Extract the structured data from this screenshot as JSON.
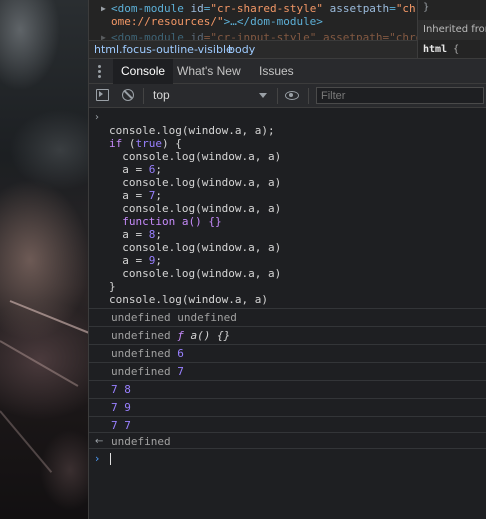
{
  "elements": {
    "line1": {
      "tag_open": "<dom-module ",
      "attr_name": "id",
      "attr_eq": "=",
      "attr_value": "\"cr-shared-style\"",
      "attr2_name": " assetpath",
      "attr2_eq": "=",
      "attr2_value": "\"chr"
    },
    "line2": {
      "value_cont": "ome://resources/\"",
      "tag_rest": ">…</dom-module>"
    },
    "line3": {
      "tag_open": "<dom-module ",
      "attr_name": "id",
      "attr_value": "=\"cr-input-style\" assetpath=\"chro"
    },
    "breadcrumbs": [
      "html.focus-outline-visible",
      "body"
    ]
  },
  "styles": {
    "brace": "}",
    "inherited_label": "Inherited from",
    "selector": "html",
    "selector_brace": "{"
  },
  "tabs": [
    {
      "label": "Console",
      "active": true
    },
    {
      "label": "What's New",
      "active": false
    },
    {
      "label": "Issues",
      "active": false
    }
  ],
  "toolbar": {
    "context": "top",
    "filter_placeholder": "Filter",
    "filter_value": ""
  },
  "console": {
    "input_lines": [
      "console.log(window.a, a);",
      "if (true) {",
      "  console.log(window.a, a)",
      "  a = 6;",
      "  console.log(window.a, a)",
      "  a = 7;",
      "  console.log(window.a, a)",
      "  function a() {}",
      "  a = 8;",
      "  console.log(window.a, a)",
      "  a = 9;",
      "  console.log(window.a, a)",
      "}",
      "console.log(window.a, a)"
    ],
    "outputs": [
      {
        "left": "undefined",
        "right": "undefined"
      },
      {
        "left": "undefined",
        "right": "ƒ a() {}"
      },
      {
        "left": "undefined",
        "right": "6"
      },
      {
        "left": "undefined",
        "right": "7"
      },
      {
        "left": "7",
        "right": "8"
      },
      {
        "left": "7",
        "right": "9"
      },
      {
        "left": "7",
        "right": "7"
      }
    ],
    "return_value": "undefined"
  },
  "icons": {
    "prompt": "chevron-right-icon",
    "return": "return-arrow-icon",
    "menu": "kebab-menu-icon",
    "sidebar": "sidebar-toggle-icon",
    "clear": "clear-console-icon",
    "eye": "live-expression-eye-icon"
  }
}
